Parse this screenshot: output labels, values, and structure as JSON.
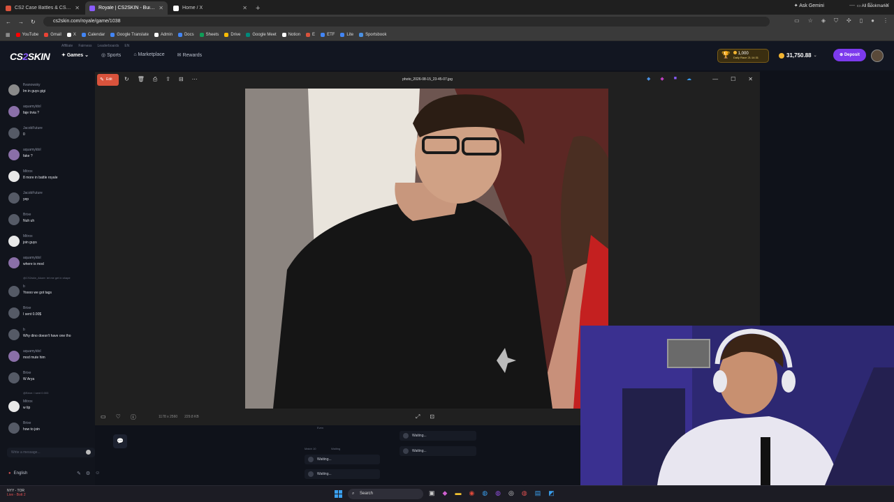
{
  "browser": {
    "tabs": [
      {
        "title": "CS2 Case Battles & CSGO Case",
        "active": false,
        "color": "#d9533c"
      },
      {
        "title": "Royale | CS2SKIN - Built for pl",
        "active": true,
        "color": "#8a5cff"
      },
      {
        "title": "Home / X",
        "active": false,
        "color": "#ffffff"
      }
    ],
    "new_tab": "+",
    "ask_gemini": "Ask Gemini",
    "url": "cs2skin.com/royale/game/1038",
    "bookmarks": [
      {
        "label": "YouTube",
        "color": "#ff0000"
      },
      {
        "label": "Gmail",
        "color": "#ea4335"
      },
      {
        "label": "X",
        "color": "#ffffff"
      },
      {
        "label": "Calendar",
        "color": "#4285f4"
      },
      {
        "label": "Google Translate",
        "color": "#4285f4"
      },
      {
        "label": "Admin",
        "color": "#ffffff"
      },
      {
        "label": "Docs",
        "color": "#4285f4"
      },
      {
        "label": "Sheets",
        "color": "#0f9d58"
      },
      {
        "label": "Drive",
        "color": "#fbbc04"
      },
      {
        "label": "Google Meet",
        "color": "#00897b"
      },
      {
        "label": "Notion",
        "color": "#ffffff"
      },
      {
        "label": "E",
        "color": "#d9533c"
      },
      {
        "label": "ETF",
        "color": "#4285f4"
      },
      {
        "label": "Lite",
        "color": "#4285f4"
      },
      {
        "label": "Sportsbook",
        "color": "#4a90e2"
      }
    ],
    "all_bookmarks": "All Bookmarks"
  },
  "site": {
    "logo_a": "CS",
    "logo_b": "2",
    "logo_c": "SKIN",
    "affiliates": [
      "Affiliate",
      "Fairness",
      "Leaderboards",
      "EN"
    ],
    "nav": [
      {
        "label": "Games",
        "active": true
      },
      {
        "label": "Sports",
        "active": false
      },
      {
        "label": "Marketplace",
        "active": false
      },
      {
        "label": "Rewards",
        "active": false
      }
    ],
    "race_amount": "1,000",
    "race_label": "Daily Race 21:14:31",
    "balance": "31,750.88",
    "deposit": "Deposit"
  },
  "chat": {
    "messages": [
      {
        "user": "flvanowsky",
        "text": "Im in guys gigi",
        "color": "#8a8a8a"
      },
      {
        "user": "aquamyldol",
        "text": "faje trvia ?",
        "color": "#8a6fa8"
      },
      {
        "user": "JacobFuture",
        "text": "0",
        "color": "#555a66"
      },
      {
        "user": "aquamyldol",
        "text": "fake ?",
        "color": "#8a6fa8"
      },
      {
        "user": "Mitrox",
        "text": "8 more in battle royale",
        "color": "#e8e8e8"
      },
      {
        "user": "JacobFuture",
        "text": "yep",
        "color": "#555a66"
      },
      {
        "user": "Brixe",
        "text": "Nuh uh",
        "color": "#555a66"
      },
      {
        "user": "Mitrox",
        "text": "join guys",
        "color": "#e8e8e8"
      },
      {
        "user": "aquamyldol",
        "text": "where is mod",
        "color": "#8a6fa8"
      },
      {
        "user": "b",
        "reply": "@CS2skin_Akore: let me get in shape",
        "text": "Yoooo we got tags",
        "color": "#555a66"
      },
      {
        "user": "Brixe",
        "text": "I sent 0.00$",
        "color": "#555a66"
      },
      {
        "user": "b",
        "text": "Why dino doesn't have one tho",
        "color": "#555a66"
      },
      {
        "user": "aquamyldol",
        "text": "mod mute him",
        "color": "#8a6fa8"
      },
      {
        "user": "Brixe",
        "text": "W Arya",
        "color": "#555a66"
      },
      {
        "user": "Mitrox",
        "reply": "@Brixe: I sent 0.003",
        "text": "w tip",
        "color": "#e8e8e8"
      },
      {
        "user": "Brixe",
        "text": "how to join",
        "color": "#555a66"
      }
    ],
    "input_placeholder": "Write a message...",
    "language": "English"
  },
  "game": {
    "match_label": "Match 10",
    "status_label": "Waiting",
    "even_label": "Even",
    "waiting_text": "Waiting..."
  },
  "viewer": {
    "edit_label": "Edit",
    "filename": "photo_2026-08-15_23-45-07.jpg",
    "dimensions": "1178 x 2560",
    "filesize": "229.8 KB"
  },
  "taskbar": {
    "weather_title": "NYY - TOR",
    "weather_sub": "Live - Bott 2",
    "search": "Search"
  },
  "colors": {
    "accent": "#7c3aed",
    "edit_button": "#d9533c",
    "race_gold": "#f2c230"
  }
}
